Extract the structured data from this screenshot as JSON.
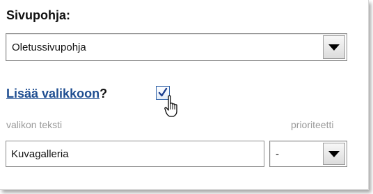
{
  "form": {
    "template_label": "Sivupohja:",
    "template_value": "Oletussivupohja",
    "add_to_menu_link": "Lisää valikkoon",
    "add_to_menu_suffix": "?",
    "add_to_menu_checked": true,
    "menu_text_label": "valikon teksti",
    "priority_label": "prioriteetti",
    "menu_text_value": "Kuvagalleria",
    "priority_value": "-"
  },
  "icons": {
    "dropdown": "triangle-down-icon",
    "checkmark": "checkmark-icon",
    "cursor": "hand-pointer-icon"
  },
  "colors": {
    "link": "#1f4e91",
    "muted_label": "#9a9a9a",
    "checkbox_border": "#2a5ea5"
  }
}
